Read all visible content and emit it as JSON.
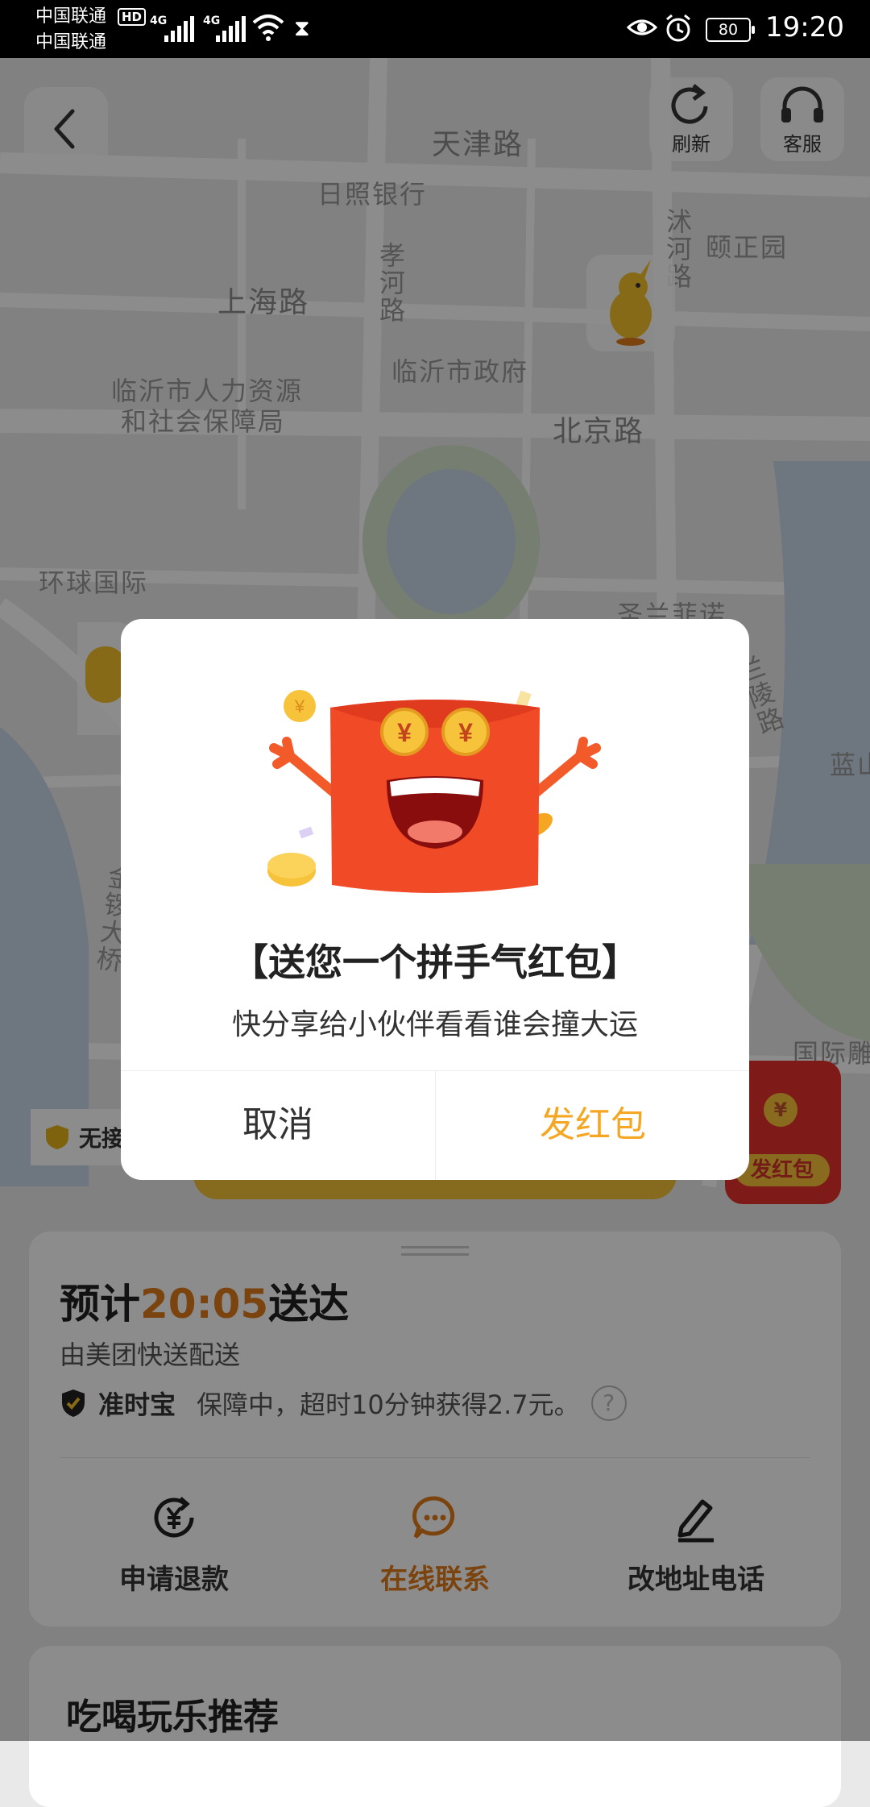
{
  "status_bar": {
    "carrier_1": "中国联通",
    "carrier_2": "中国联通",
    "hd": "HD",
    "network_1": "4G",
    "network_2": "4G",
    "battery": "80",
    "time": "19:20"
  },
  "map": {
    "labels": {
      "tianjin_rd": "天津路",
      "rizhao_bank": "日照银行",
      "yizheng_yuan": "颐正园",
      "shanghai_rd": "上海路",
      "xiaohe_rd": "孝河路",
      "shuhe_rd": "沭河路",
      "linyi_gov": "临沂市政府",
      "hr_bureau_1": "临沂市人力资源",
      "hr_bureau_2": "和社会保障局",
      "beijing_rd": "北京路",
      "huanqiu": "环球国际",
      "shenglan": "圣兰菲诺",
      "lanling_rd": "兰陵路",
      "lanshan": "蓝山",
      "jinluo_bridge": "金锣大桥",
      "guoji": "国际雕"
    },
    "refresh_label": "刷新",
    "service_label": "客服"
  },
  "floating": {
    "contactless_badge": "无接触",
    "red_packet_label": "发红包",
    "coin_symbol": "¥"
  },
  "order_card": {
    "eta_prefix": "预计",
    "eta_time": "20:05",
    "eta_suffix": "送达",
    "carrier": "由美团快送配送",
    "guarantee_brand": "准时宝",
    "guarantee_desc": "保障中，超时10分钟获得2.7元。",
    "help": "?",
    "actions": [
      {
        "label": "申请退款",
        "icon": "refund-icon"
      },
      {
        "label": "在线联系",
        "icon": "chat-icon"
      },
      {
        "label": "改地址电话",
        "icon": "edit-icon"
      }
    ]
  },
  "recommend": {
    "title": "吃喝玩乐推荐"
  },
  "dialog": {
    "title": "【送您一个拼手气红包】",
    "subtitle": "快分享给小伙伴看看谁会撞大运",
    "cancel": "取消",
    "confirm": "发红包"
  },
  "colors": {
    "accent_orange": "#e07b1a",
    "confirm_yellow": "#f5a623",
    "red_packet": "#e5312b"
  }
}
